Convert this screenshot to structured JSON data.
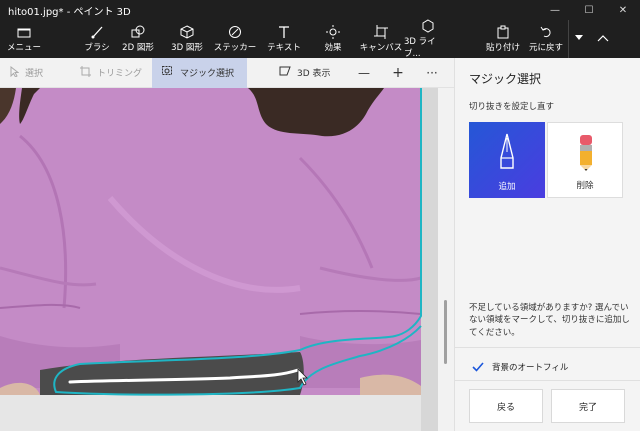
{
  "titlebar": {
    "title": "hito01.jpg* - ペイント 3D",
    "min": "—",
    "max": "☐",
    "close": "✕"
  },
  "ribbon": {
    "menu": "メニュー",
    "brush": "ブラシ",
    "shapes2d": "2D 図形",
    "shapes3d": "3D 図形",
    "stickers": "ステッカー",
    "text": "テキスト",
    "effects": "効果",
    "canvas": "キャンバス",
    "library3d": "3D ライブ...",
    "paste": "貼り付け",
    "undo": "元に戻す"
  },
  "toolbar": {
    "select": "選択",
    "crop": "トリミング",
    "magic_select": "マジック選択",
    "view3d": "3D 表示",
    "zoom_out": "—",
    "zoom_in": "+",
    "more": "···"
  },
  "panel": {
    "title": "マジック選択",
    "subtitle": "切り抜きを設定し直す",
    "add_label": "追加",
    "remove_label": "削除",
    "hint": "不足している領域がありますか? 選んでいない領域をマークして、切り抜きに追加してください。",
    "autofill_label": "背景のオートフィル",
    "back_label": "戻る",
    "done_label": "完了"
  },
  "colors": {
    "accent": "#2557d6",
    "selection_outline": "#1fb5c4",
    "shirt": "#c48ac6"
  }
}
